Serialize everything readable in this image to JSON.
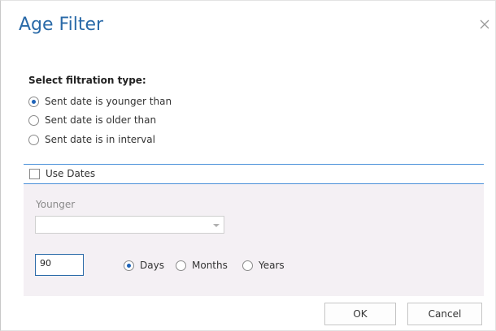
{
  "dialog": {
    "title": "Age Filter",
    "close_icon": "close-icon"
  },
  "filtration": {
    "heading": "Select filtration type:",
    "options": [
      {
        "label": "Sent date is younger than",
        "checked": true
      },
      {
        "label": "Sent date is older than",
        "checked": false
      },
      {
        "label": "Sent date is in interval",
        "checked": false
      }
    ]
  },
  "use_dates": {
    "label": "Use Dates",
    "checked": false
  },
  "younger": {
    "label": "Younger",
    "selected_value": ""
  },
  "amount": {
    "value": "90"
  },
  "units": [
    {
      "label": "Days",
      "checked": true
    },
    {
      "label": "Months",
      "checked": false
    },
    {
      "label": "Years",
      "checked": false
    }
  ],
  "buttons": {
    "ok_label": "OK",
    "cancel_label": "Cancel"
  },
  "colors": {
    "title": "#2a6aa8",
    "accent": "#4a90d9",
    "radio_checked": "#1e63b8",
    "panel_bg": "#f4f0f4"
  }
}
